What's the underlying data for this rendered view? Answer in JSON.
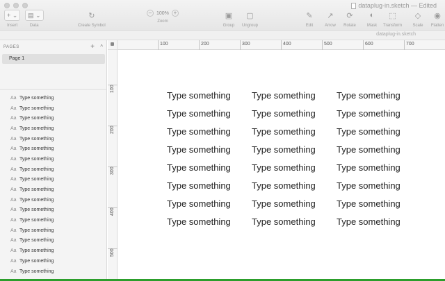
{
  "window": {
    "title": "dataplug-in.sketch — Edited",
    "subtitle_filename": "dataplug-in.sketch"
  },
  "toolbar": {
    "insert_label": "Insert",
    "data_label": "Data",
    "create_symbol_label": "Create Symbol",
    "zoom_label": "Zoom",
    "zoom_value": "100%",
    "zoom_minus": "–",
    "zoom_plus": "+",
    "group_label": "Group",
    "ungroup_label": "Ungroup",
    "edit_label": "Edit",
    "arrow_label": "Arrow",
    "rotate_label": "Rotate",
    "mask_label": "Mask",
    "transform_label": "Transform",
    "scale_label": "Scale",
    "flatten_label": "Flatten"
  },
  "sidebar": {
    "pages_header": "PAGES",
    "add_symbol": "+",
    "collapse_symbol": "^",
    "pages": [
      {
        "label": "Page 1"
      }
    ],
    "layer_icon_text": "Aa",
    "layers": [
      {
        "label": "Type something"
      },
      {
        "label": "Type something"
      },
      {
        "label": "Type something"
      },
      {
        "label": "Type something"
      },
      {
        "label": "Type something"
      },
      {
        "label": "Type something"
      },
      {
        "label": "Type something"
      },
      {
        "label": "Type something"
      },
      {
        "label": "Type something"
      },
      {
        "label": "Type something"
      },
      {
        "label": "Type something"
      },
      {
        "label": "Type something"
      },
      {
        "label": "Type something"
      },
      {
        "label": "Type something"
      },
      {
        "label": "Type something"
      },
      {
        "label": "Type something"
      },
      {
        "label": "Type something"
      },
      {
        "label": "Type something"
      }
    ]
  },
  "rulers": {
    "horizontal": [
      "100",
      "200",
      "300",
      "400",
      "500",
      "600",
      "700"
    ],
    "vertical": [
      "100",
      "200",
      "300",
      "400",
      "500"
    ]
  },
  "canvas": {
    "columns": 3,
    "rows": 8,
    "text": "Type something"
  }
}
